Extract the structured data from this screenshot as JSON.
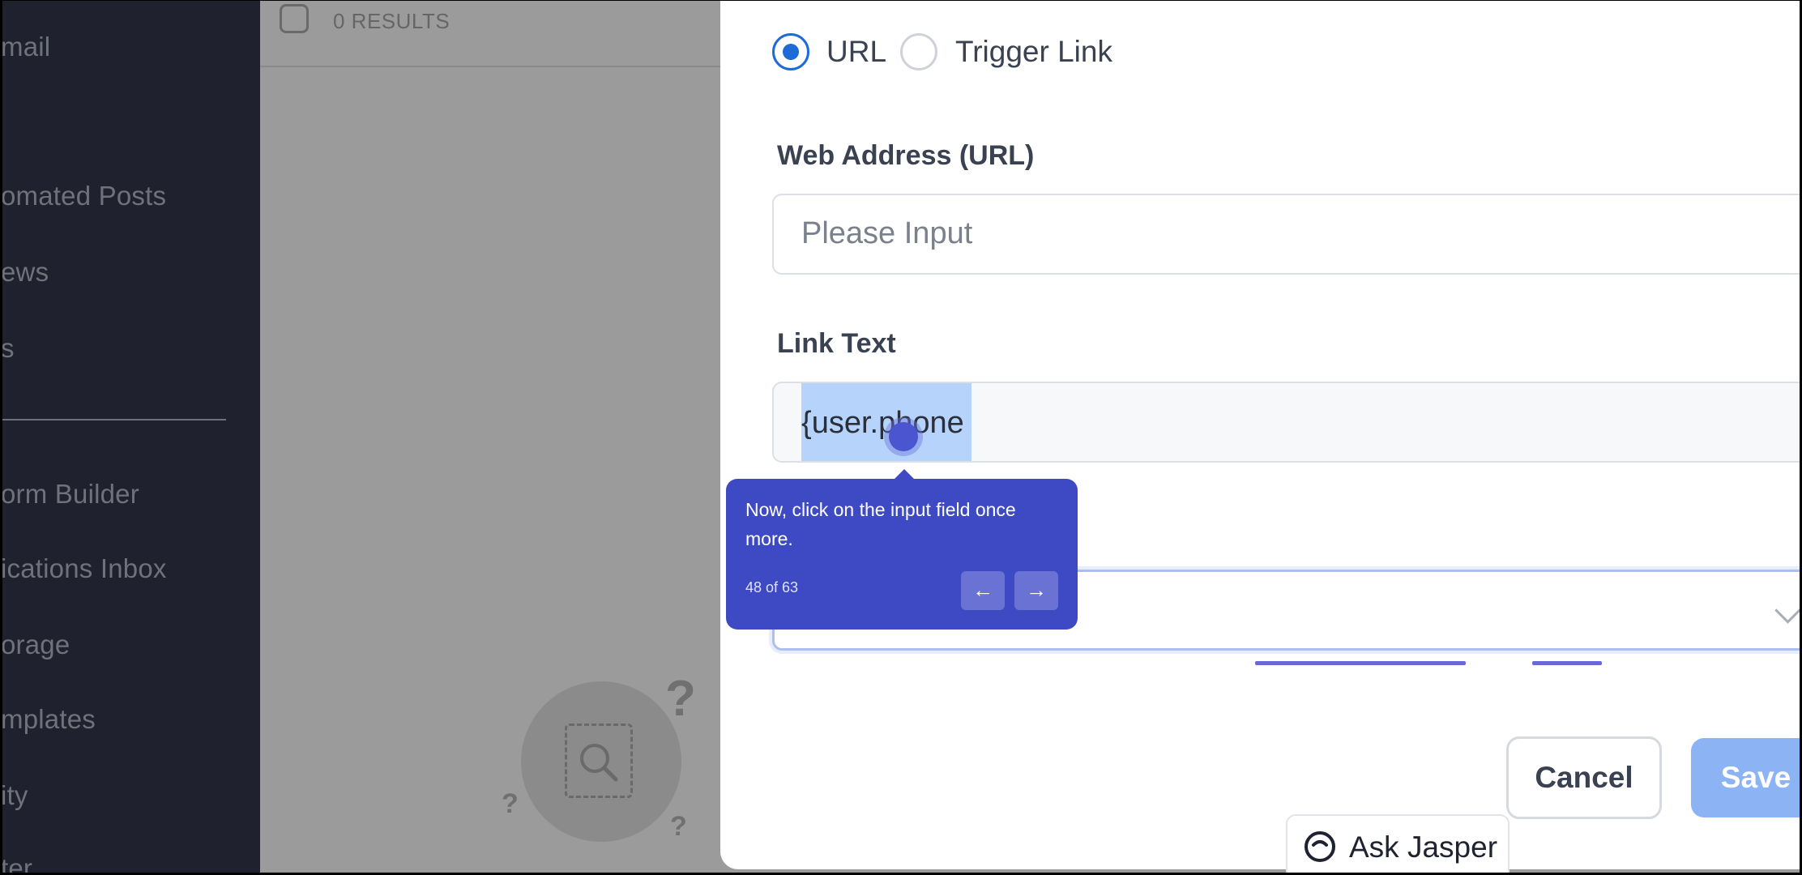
{
  "sidebar": {
    "items": [
      {
        "label": "mail"
      },
      {
        "label": "omated Posts"
      },
      {
        "label": "ews"
      },
      {
        "label": "s"
      },
      {
        "label": "orm Builder"
      },
      {
        "label": "ications Inbox"
      },
      {
        "label": "orage"
      },
      {
        "label": "mplates"
      },
      {
        "label": "ity"
      },
      {
        "label": "ter"
      }
    ]
  },
  "list": {
    "results_label": "0 RESULTS",
    "empty_marks": [
      "?",
      "?",
      "?"
    ]
  },
  "modal": {
    "link_type": {
      "options": [
        {
          "label": "URL",
          "selected": true
        },
        {
          "label": "Trigger Link",
          "selected": false
        }
      ]
    },
    "web_address": {
      "label": "Web Address (URL)",
      "placeholder": "Please Input",
      "value": ""
    },
    "link_text": {
      "label": "Link Text",
      "value": "{user.phone"
    },
    "buttons": {
      "cancel": "Cancel",
      "save": "Save"
    }
  },
  "assistant": {
    "label": "Ask Jasper"
  },
  "tooltip": {
    "text": "Now, click on the input field once more.",
    "step": "48 of 63",
    "prev_icon": "arrow-left-icon",
    "next_icon": "arrow-right-icon"
  },
  "colors": {
    "accent": "#1e6ad6",
    "tooltip": "#3e4ac4",
    "save_disabled": "#8cb4f5",
    "sidebar": "#1f222e"
  }
}
